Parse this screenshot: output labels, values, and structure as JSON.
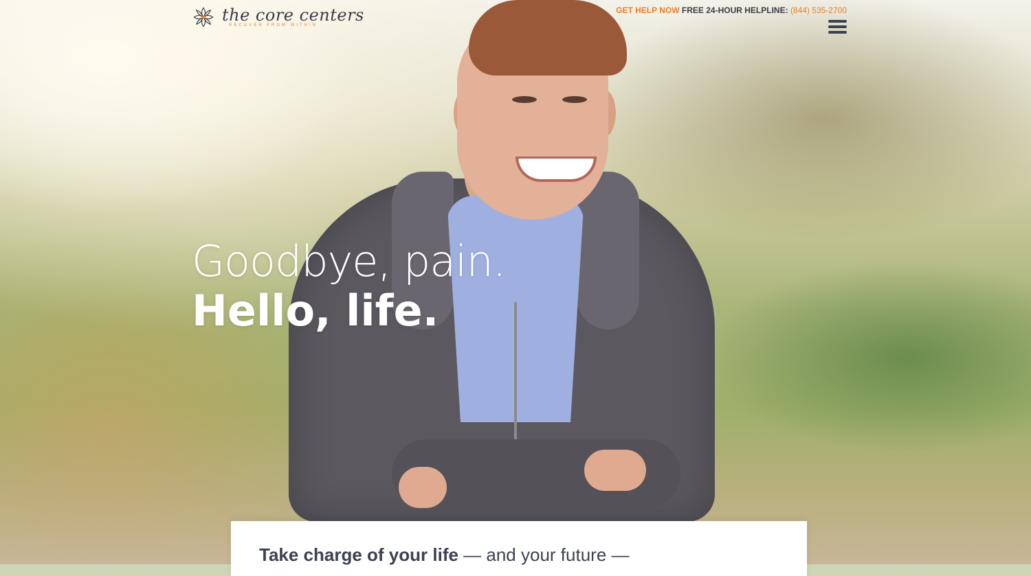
{
  "brand": {
    "name": "the core centers",
    "tagline": "RECOVER FROM WITHIN",
    "colors": {
      "accent": "#e8802a",
      "text": "#3b4150",
      "white": "#ffffff"
    }
  },
  "header": {
    "get_help": "GET HELP NOW",
    "helpline_label": "FREE 24-HOUR HELPLINE:",
    "phone": "(844) 535-2700",
    "menu_icon": "hamburger-menu-icon"
  },
  "hero": {
    "line1": "Goodbye, pain.",
    "line2": "Hello, life."
  },
  "card": {
    "bold": "Take charge of your life",
    "rest": " — and your future —"
  }
}
